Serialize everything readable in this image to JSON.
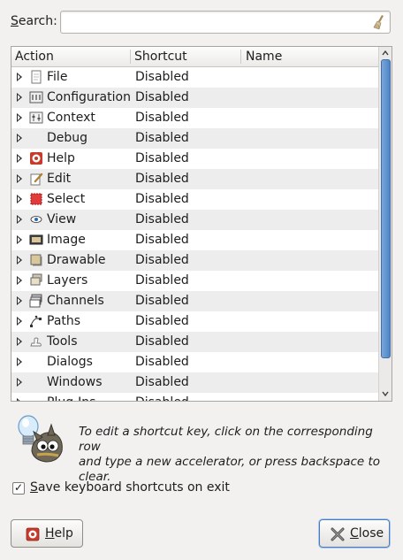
{
  "search": {
    "label_prefix": "S",
    "label_rest": "earch:",
    "value": "",
    "placeholder": ""
  },
  "tree": {
    "columns": [
      "Action",
      "Shortcut",
      "Name"
    ],
    "rows": [
      {
        "action": "File",
        "shortcut": "Disabled",
        "icon": "file-icon"
      },
      {
        "action": "Configuration",
        "shortcut": "Disabled",
        "icon": "configuration-icon"
      },
      {
        "action": "Context",
        "shortcut": "Disabled",
        "icon": "context-icon"
      },
      {
        "action": "Debug",
        "shortcut": "Disabled",
        "icon": ""
      },
      {
        "action": "Help",
        "shortcut": "Disabled",
        "icon": "help-icon"
      },
      {
        "action": "Edit",
        "shortcut": "Disabled",
        "icon": "edit-icon"
      },
      {
        "action": "Select",
        "shortcut": "Disabled",
        "icon": "select-icon"
      },
      {
        "action": "View",
        "shortcut": "Disabled",
        "icon": "eye-icon"
      },
      {
        "action": "Image",
        "shortcut": "Disabled",
        "icon": "image-icon"
      },
      {
        "action": "Drawable",
        "shortcut": "Disabled",
        "icon": "drawable-icon"
      },
      {
        "action": "Layers",
        "shortcut": "Disabled",
        "icon": "layers-icon"
      },
      {
        "action": "Channels",
        "shortcut": "Disabled",
        "icon": "channels-icon"
      },
      {
        "action": "Paths",
        "shortcut": "Disabled",
        "icon": "paths-icon"
      },
      {
        "action": "Tools",
        "shortcut": "Disabled",
        "icon": "tools-icon"
      },
      {
        "action": "Dialogs",
        "shortcut": "Disabled",
        "icon": ""
      },
      {
        "action": "Windows",
        "shortcut": "Disabled",
        "icon": ""
      },
      {
        "action": "Plug-Ins",
        "shortcut": "Disabled",
        "icon": ""
      }
    ]
  },
  "tip": {
    "line1": "To edit a shortcut key, click on the corresponding row",
    "line2": "and type a new accelerator, or press backspace to clear."
  },
  "save_option": {
    "label_prefix": "S",
    "label_rest": "ave keyboard shortcuts on exit",
    "checked": true
  },
  "buttons": {
    "help": {
      "prefix": "H",
      "rest": "elp"
    },
    "close": {
      "prefix": "C",
      "rest": "lose"
    }
  },
  "colors": {
    "scroll_thumb": "#4f85c6",
    "focus_border": "#4a7cbf",
    "alt_row": "#ededed"
  }
}
